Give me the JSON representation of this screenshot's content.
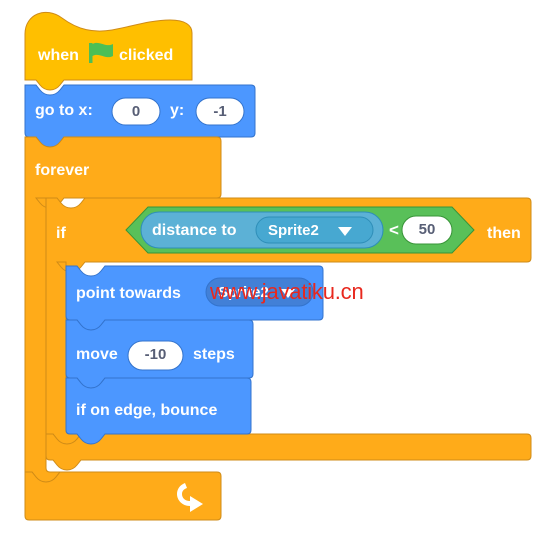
{
  "app": {
    "name": "scratch-block-editor",
    "canvas_background": "#ffffff"
  },
  "palette": {
    "events_yellow": "#FFBF00",
    "events_yellow_stroke": "#CF8B17",
    "control_orange": "#FFAB19",
    "control_orange_stroke": "#CF8B17",
    "motion_blue": "#4C97FF",
    "motion_blue_stroke": "#3373CC",
    "motion_blue_input": "#4280D7",
    "sensing_lightblue": "#5CB1D6",
    "sensing_lightblue_stroke": "#2E8EB8",
    "sensing_input": "#47A8D1",
    "operators_green": "#59C059",
    "operators_green_stroke": "#389438",
    "field_white": "#FFFFFF",
    "field_text": "#575E75",
    "flag_green": "#4CBF56",
    "watermark_red": "#E8281E"
  },
  "script": {
    "hat_block": {
      "id": "event-when-flag-clicked",
      "text_before": "when",
      "icon": "green-flag-icon",
      "text_after": "clicked"
    },
    "goto_block": {
      "id": "motion-go-to-xy",
      "label_x": "go to x:",
      "value_x": "0",
      "label_y": "y:",
      "value_y": "-1"
    },
    "forever_block": {
      "id": "control-forever",
      "label": "forever",
      "loop_icon": "loop-arrow-icon"
    },
    "if_block": {
      "id": "control-if-then",
      "label_if": "if",
      "label_then": "then"
    },
    "condition": {
      "id": "operator-less-than",
      "operator": "<",
      "right_value": "50",
      "left_reporter": {
        "id": "sensing-distance-to",
        "label": "distance to",
        "dropdown_value": "Sprite2",
        "dropdown_icon": "chevron-down-icon"
      }
    },
    "body_blocks": [
      {
        "id": "motion-point-towards",
        "label": "point towards",
        "dropdown_value": "Sprite2",
        "dropdown_icon": "chevron-down-icon"
      },
      {
        "id": "motion-move-steps",
        "label_before": "move",
        "value": "-10",
        "label_after": "steps"
      },
      {
        "id": "motion-if-on-edge-bounce",
        "label": "if on edge, bounce"
      }
    ]
  },
  "watermark": {
    "text": "www.javatiku.cn"
  }
}
